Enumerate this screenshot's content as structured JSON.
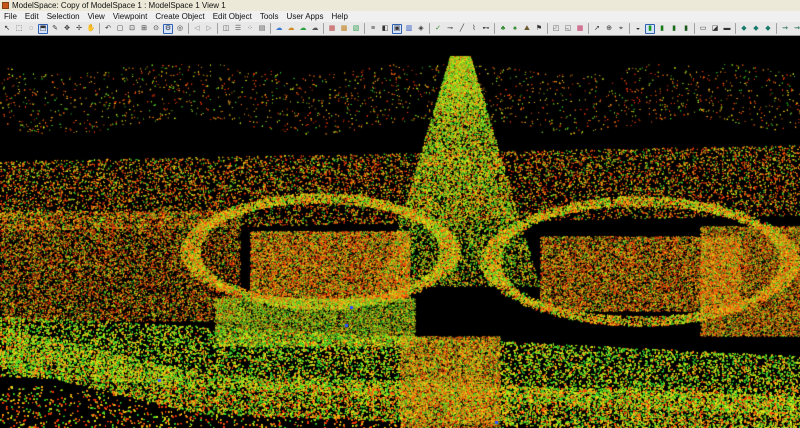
{
  "window": {
    "title": "ModelSpace: Copy of ModelSpace 1 : ModelSpace 1 View 1"
  },
  "menu": [
    "File",
    "Edit",
    "Selection",
    "View",
    "Viewpoint",
    "Create Object",
    "Edit Object",
    "Tools",
    "User Apps",
    "Help"
  ],
  "toolbar": {
    "tools": [
      {
        "name": "select-arrow-icon",
        "glyph": "↖",
        "color": "#222"
      },
      {
        "name": "select-rect-icon",
        "glyph": "⬚",
        "color": "#333"
      },
      {
        "name": "select-lasso-icon",
        "glyph": "◌",
        "color": "#333"
      },
      {
        "name": "select-fence-icon",
        "glyph": "⬒",
        "color": "#333",
        "active": true
      },
      {
        "name": "pencil-icon",
        "glyph": "✎",
        "color": "#333"
      },
      {
        "name": "move-icon",
        "glyph": "✥",
        "color": "#333"
      },
      {
        "name": "rotate-icon",
        "glyph": "✢",
        "color": "#333"
      },
      {
        "name": "pan-icon",
        "glyph": "✋",
        "color": "#333"
      },
      {
        "sep": true
      },
      {
        "name": "undo-icon",
        "glyph": "↶",
        "color": "#333"
      },
      {
        "name": "box-view-icon",
        "glyph": "▢",
        "color": "#333"
      },
      {
        "name": "fit-view-icon",
        "glyph": "⊡",
        "color": "#333"
      },
      {
        "name": "zoom-window-icon",
        "glyph": "⊞",
        "color": "#333"
      },
      {
        "name": "zoom-icon",
        "glyph": "⊙",
        "color": "#333"
      },
      {
        "name": "settings-icon",
        "glyph": "⚙",
        "color": "#333",
        "active": true
      },
      {
        "name": "orbit-icon",
        "glyph": "◎",
        "color": "#333"
      },
      {
        "sep": true
      },
      {
        "name": "back-icon",
        "glyph": "◁",
        "color": "#888"
      },
      {
        "name": "forward-icon",
        "glyph": "▷",
        "color": "#888"
      },
      {
        "sep": true
      },
      {
        "name": "view-cube-icon",
        "glyph": "◫",
        "color": "#555"
      },
      {
        "name": "view-layers-icon",
        "glyph": "☰",
        "color": "#555"
      },
      {
        "name": "view-points-icon",
        "glyph": "⁘",
        "color": "#555"
      },
      {
        "name": "view-surface-icon",
        "glyph": "▤",
        "color": "#555"
      },
      {
        "sep": true
      },
      {
        "name": "cloud-icon",
        "glyph": "☁",
        "color": "#3a7ad0"
      },
      {
        "name": "cloud-filter-icon",
        "glyph": "☁",
        "color": "#d08a20"
      },
      {
        "name": "cloud-color-icon",
        "glyph": "☁",
        "color": "#2aa040"
      },
      {
        "name": "cloud-merge-icon",
        "glyph": "☁",
        "color": "#555"
      },
      {
        "sep": true
      },
      {
        "name": "color-map-icon",
        "glyph": "▦",
        "color": "#c04040"
      },
      {
        "name": "intensity-icon",
        "glyph": "▩",
        "color": "#c08020"
      },
      {
        "name": "elevation-icon",
        "glyph": "▧",
        "color": "#30a050"
      },
      {
        "sep": true
      },
      {
        "name": "list-icon",
        "glyph": "≡",
        "color": "#333"
      },
      {
        "name": "render-icon",
        "glyph": "◧",
        "color": "#333"
      },
      {
        "name": "layer-active-icon",
        "glyph": "▣",
        "color": "#333",
        "active": true
      },
      {
        "name": "chart-bars-icon",
        "glyph": "▥",
        "color": "#2050c0"
      },
      {
        "name": "layer-stack-icon",
        "glyph": "◈",
        "color": "#333"
      },
      {
        "sep": true
      },
      {
        "name": "check-icon",
        "glyph": "✓",
        "color": "#2a8a2a"
      },
      {
        "name": "measure-icon",
        "glyph": "⊸",
        "color": "#333"
      },
      {
        "name": "line-icon",
        "glyph": "╱",
        "color": "#333"
      },
      {
        "name": "polyline-icon",
        "glyph": "⌇",
        "color": "#333"
      },
      {
        "name": "dimension-icon",
        "glyph": "⊷",
        "color": "#333"
      },
      {
        "sep": true
      },
      {
        "name": "plant-icon",
        "glyph": "♣",
        "color": "#2a8a2a"
      },
      {
        "name": "tree-icon",
        "glyph": "♠",
        "color": "#2a8a2a"
      },
      {
        "name": "terrain-icon",
        "glyph": "⛰",
        "color": "#6a5a30"
      },
      {
        "name": "flag-icon",
        "glyph": "⚑",
        "color": "#333"
      },
      {
        "sep": true
      },
      {
        "name": "mesh-icon",
        "glyph": "◰",
        "color": "#555"
      },
      {
        "name": "section-icon",
        "glyph": "◱",
        "color": "#555"
      },
      {
        "name": "rgb-icon",
        "glyph": "▦",
        "color": "#c03060"
      },
      {
        "sep": true
      },
      {
        "name": "cursor-icon",
        "glyph": "➚",
        "color": "#333"
      },
      {
        "name": "target-icon",
        "glyph": "⊕",
        "color": "#333"
      },
      {
        "name": "snap-icon",
        "glyph": "⌖",
        "color": "#333"
      },
      {
        "sep": true
      },
      {
        "name": "gauge-icon",
        "glyph": "◒",
        "color": "#333"
      },
      {
        "name": "battery-full-icon",
        "glyph": "▮",
        "color": "#1a9a1a",
        "active": true
      },
      {
        "name": "battery-level2-icon",
        "glyph": "▮",
        "color": "#1a7a1a"
      },
      {
        "name": "battery-level3-icon",
        "glyph": "▮",
        "color": "#1a6a1a"
      },
      {
        "name": "battery-level4-icon",
        "glyph": "▮",
        "color": "#1a5a1a"
      },
      {
        "sep": true
      },
      {
        "name": "tile-icon",
        "glyph": "▭",
        "color": "#333"
      },
      {
        "name": "palette-icon",
        "glyph": "◪",
        "color": "#333"
      },
      {
        "name": "display-icon",
        "glyph": "▬",
        "color": "#333"
      },
      {
        "sep": true
      },
      {
        "name": "point-size-1-icon",
        "glyph": "◆",
        "color": "#1a7a6a"
      },
      {
        "name": "point-size-2-icon",
        "glyph": "◆",
        "color": "#1a7a6a"
      },
      {
        "name": "point-size-3-icon",
        "glyph": "◆",
        "color": "#1a7a6a"
      },
      {
        "sep": true
      },
      {
        "name": "link-1-icon",
        "glyph": "⇝",
        "color": "#1a6a50"
      },
      {
        "name": "link-2-icon",
        "glyph": "⇝",
        "color": "#1a6a50"
      },
      {
        "name": "link-3-icon",
        "glyph": "⇝",
        "color": "#1a6a50"
      },
      {
        "name": "link-4-icon",
        "glyph": "⇝",
        "color": "#1a6a50"
      }
    ]
  },
  "viewport": {
    "content": "point-cloud-3d-view",
    "palette": [
      "#ff3b0a",
      "#ff6a10",
      "#ff9a18",
      "#ffd21a",
      "#d8f01a",
      "#7fe020",
      "#2fd030"
    ]
  }
}
